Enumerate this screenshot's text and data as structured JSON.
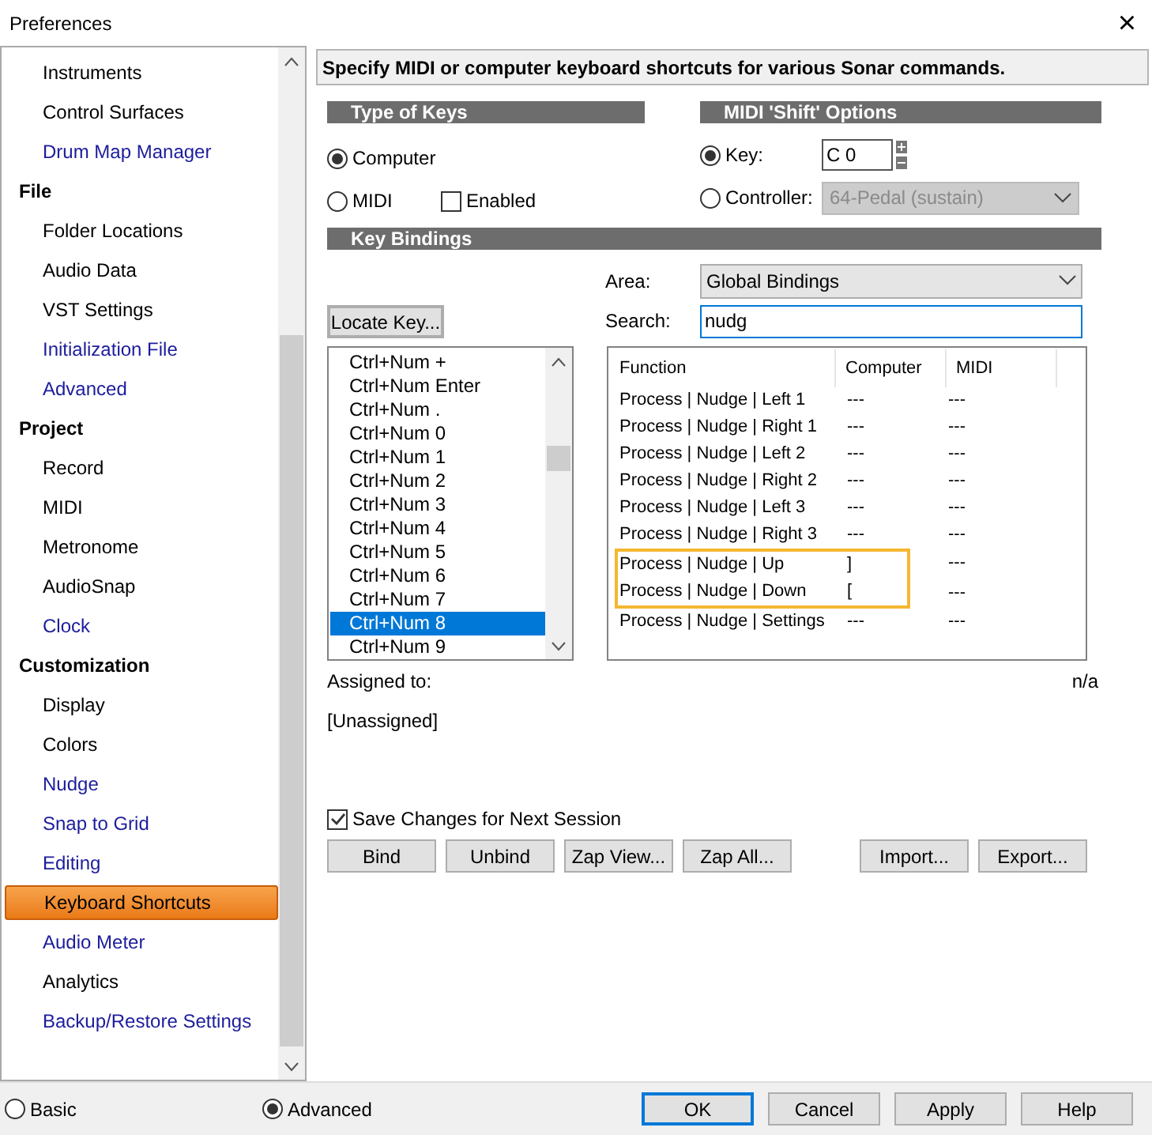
{
  "window": {
    "title": "Preferences",
    "close": "×"
  },
  "sidebar": {
    "items": [
      {
        "kind": "item",
        "label": "Instruments",
        "color": "#000000",
        "selected": false
      },
      {
        "kind": "item",
        "label": "Control Surfaces",
        "color": "#000000",
        "selected": false
      },
      {
        "kind": "item",
        "label": "Drum Map Manager",
        "color": "#1c1c9c",
        "selected": false
      },
      {
        "kind": "header",
        "label": "File"
      },
      {
        "kind": "item",
        "label": "Folder Locations",
        "color": "#000000",
        "selected": false
      },
      {
        "kind": "item",
        "label": "Audio Data",
        "color": "#000000",
        "selected": false
      },
      {
        "kind": "item",
        "label": "VST Settings",
        "color": "#000000",
        "selected": false
      },
      {
        "kind": "item",
        "label": "Initialization File",
        "color": "#1c1c9c",
        "selected": false
      },
      {
        "kind": "item",
        "label": "Advanced",
        "color": "#1c1c9c",
        "selected": false
      },
      {
        "kind": "header",
        "label": "Project"
      },
      {
        "kind": "item",
        "label": "Record",
        "color": "#000000",
        "selected": false
      },
      {
        "kind": "item",
        "label": "MIDI",
        "color": "#000000",
        "selected": false
      },
      {
        "kind": "item",
        "label": "Metronome",
        "color": "#000000",
        "selected": false
      },
      {
        "kind": "item",
        "label": "AudioSnap",
        "color": "#000000",
        "selected": false
      },
      {
        "kind": "item",
        "label": "Clock",
        "color": "#1c1c9c",
        "selected": false
      },
      {
        "kind": "header",
        "label": "Customization"
      },
      {
        "kind": "item",
        "label": "Display",
        "color": "#000000",
        "selected": false
      },
      {
        "kind": "item",
        "label": "Colors",
        "color": "#000000",
        "selected": false
      },
      {
        "kind": "item",
        "label": "Nudge",
        "color": "#1c1c9c",
        "selected": false
      },
      {
        "kind": "item",
        "label": "Snap to Grid",
        "color": "#1c1c9c",
        "selected": false
      },
      {
        "kind": "item",
        "label": "Editing",
        "color": "#1c1c9c",
        "selected": false
      },
      {
        "kind": "item",
        "label": "Keyboard Shortcuts",
        "color": "#000000",
        "selected": true
      },
      {
        "kind": "item",
        "label": "Audio Meter",
        "color": "#1c1c9c",
        "selected": false
      },
      {
        "kind": "item",
        "label": "Analytics",
        "color": "#000000",
        "selected": false
      },
      {
        "kind": "item",
        "label": "Backup/Restore Settings",
        "color": "#1c1c9c",
        "selected": false
      }
    ]
  },
  "description": "Specify MIDI or computer keyboard shortcuts for various Sonar commands.",
  "type_of_keys": {
    "title": "Type of Keys",
    "options": [
      {
        "label": "Computer",
        "selected": true
      },
      {
        "label": "MIDI",
        "selected": false
      }
    ],
    "enabled": {
      "label": "Enabled",
      "checked": false
    }
  },
  "shift_options": {
    "title": "MIDI 'Shift' Options",
    "key": {
      "label": "Key:",
      "selected": true,
      "value": "C 0"
    },
    "controller": {
      "label": "Controller:",
      "selected": false,
      "value": "64-Pedal (sustain)",
      "disabled": true
    }
  },
  "key_bindings": {
    "title": "Key Bindings",
    "locate_button": "Locate Key...",
    "area": {
      "label": "Area:",
      "value": "Global Bindings"
    },
    "search": {
      "label": "Search:",
      "value": "nudg"
    },
    "keys": [
      {
        "label": "Ctrl+Num +",
        "selected": false
      },
      {
        "label": "Ctrl+Num Enter",
        "selected": false
      },
      {
        "label": "Ctrl+Num .",
        "selected": false
      },
      {
        "label": "Ctrl+Num 0",
        "selected": false
      },
      {
        "label": "Ctrl+Num 1",
        "selected": false
      },
      {
        "label": "Ctrl+Num 2",
        "selected": false
      },
      {
        "label": "Ctrl+Num 3",
        "selected": false
      },
      {
        "label": "Ctrl+Num 4",
        "selected": false
      },
      {
        "label": "Ctrl+Num 5",
        "selected": false
      },
      {
        "label": "Ctrl+Num 6",
        "selected": false
      },
      {
        "label": "Ctrl+Num 7",
        "selected": false
      },
      {
        "label": "Ctrl+Num 8",
        "selected": true
      },
      {
        "label": "Ctrl+Num 9",
        "selected": false
      }
    ],
    "table": {
      "columns": [
        "Function",
        "Computer",
        "MIDI"
      ],
      "rows": [
        {
          "cells": [
            "Process | Nudge | Left 1",
            "---",
            "---"
          ],
          "highlighted": false
        },
        {
          "cells": [
            "Process | Nudge | Right 1",
            "---",
            "---"
          ],
          "highlighted": false
        },
        {
          "cells": [
            "Process | Nudge | Left 2",
            "---",
            "---"
          ],
          "highlighted": false
        },
        {
          "cells": [
            "Process | Nudge | Right 2",
            "---",
            "---"
          ],
          "highlighted": false
        },
        {
          "cells": [
            "Process | Nudge | Left 3",
            "---",
            "---"
          ],
          "highlighted": false
        },
        {
          "cells": [
            "Process | Nudge | Right 3",
            "---",
            "---"
          ],
          "highlighted": false
        },
        {
          "cells": [
            "Process | Nudge | Up",
            "]",
            "---"
          ],
          "highlighted": true
        },
        {
          "cells": [
            "Process | Nudge | Down",
            "[",
            "---"
          ],
          "highlighted": true
        },
        {
          "cells": [
            "Process | Nudge | Settings",
            "---",
            "---"
          ],
          "highlighted": false
        }
      ]
    },
    "assigned_label": "Assigned to:",
    "assigned_value": "n/a",
    "assigned_function": "[Unassigned]",
    "save_changes": {
      "label": "Save Changes for Next Session",
      "checked": true
    },
    "buttons": [
      "Bind",
      "Unbind",
      "Zap View...",
      "Zap All..."
    ],
    "io_buttons": [
      "Import...",
      "Export..."
    ]
  },
  "mode": [
    {
      "label": "Basic",
      "selected": false
    },
    {
      "label": "Advanced",
      "selected": true
    }
  ],
  "footer_buttons": [
    {
      "label": "OK",
      "default": true
    },
    {
      "label": "Cancel",
      "default": false
    },
    {
      "label": "Apply",
      "default": false
    },
    {
      "label": "Help",
      "default": false
    }
  ]
}
